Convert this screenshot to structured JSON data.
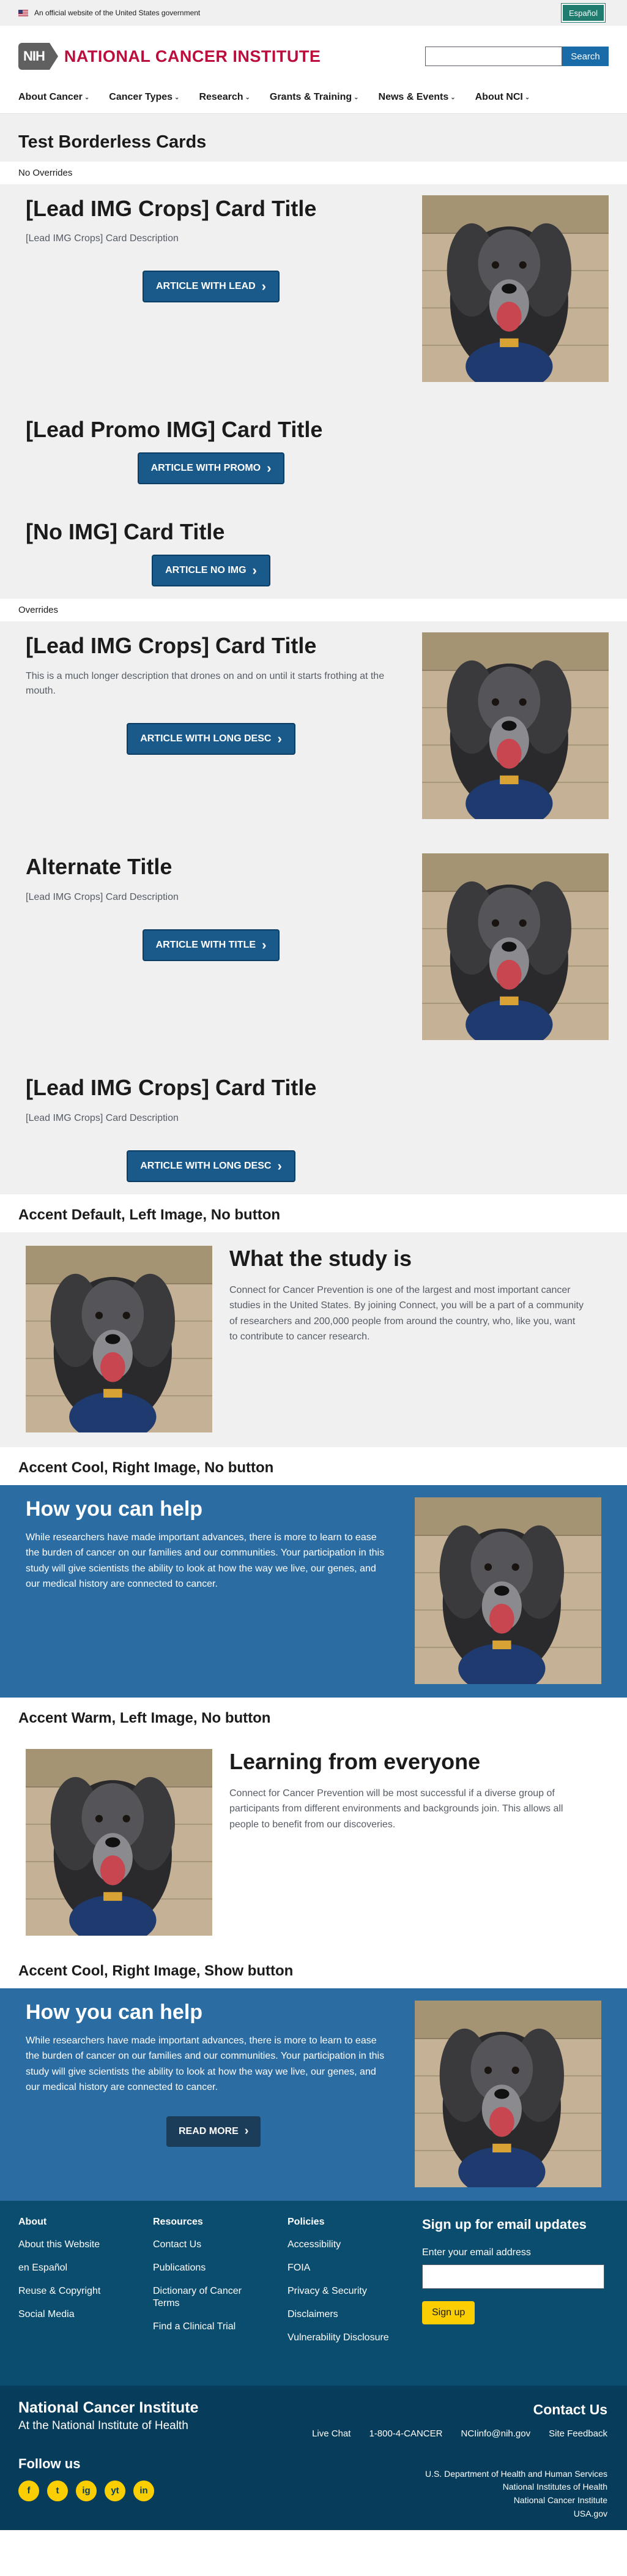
{
  "banner": {
    "text": "An official website of the United States government",
    "espanol": "Español"
  },
  "header": {
    "logo_nih": "NIH",
    "logo_name": "NATIONAL CANCER INSTITUTE",
    "search_button": "Search"
  },
  "nav": [
    {
      "label": "About Cancer"
    },
    {
      "label": "Cancer Types"
    },
    {
      "label": "Research"
    },
    {
      "label": "Grants & Training"
    },
    {
      "label": "News & Events"
    },
    {
      "label": "About NCI"
    }
  ],
  "page_title": "Test Borderless Cards",
  "no_overrides": {
    "label": "No Overrides",
    "cards": [
      {
        "title": "[Lead IMG Crops] Card Title",
        "desc": "[Lead IMG Crops] Card Description",
        "button": "ARTICLE WITH LEAD"
      },
      {
        "title": "[Lead Promo IMG] Card Title",
        "desc": "",
        "button": "ARTICLE WITH PROMO"
      },
      {
        "title": "[No IMG] Card Title",
        "desc": "",
        "button": "ARTICLE NO IMG"
      }
    ]
  },
  "overrides": {
    "label": "Overrides",
    "cards": [
      {
        "title": "[Lead IMG Crops] Card Title",
        "desc": "This is a much longer description that drones on and on until it starts frothing at the mouth.",
        "button": "ARTICLE WITH LONG DESC"
      },
      {
        "title": "Alternate Title",
        "desc": "[Lead IMG Crops] Card Description",
        "button": "ARTICLE WITH TITLE"
      },
      {
        "title": "[Lead IMG Crops] Card Title",
        "desc": "[Lead IMG Crops] Card Description",
        "button": "ARTICLE WITH LONG DESC"
      }
    ]
  },
  "accents": [
    {
      "heading": "Accent Default, Left Image, No button",
      "title": "What the study is",
      "desc": "Connect for Cancer Prevention is one of the largest and most important cancer studies in the United States. By joining Connect, you will be a part of a community of researchers and 200,000 people from around the country, who, like you, want to contribute to cancer research."
    },
    {
      "heading": "Accent Cool, Right Image, No button",
      "title": "How you can help",
      "desc": "While researchers have made important advances, there is more to learn to ease the burden of cancer on our families and our communities. Your participation in this study will give scientists the ability to look at how the way we live, our genes, and our medical history are connected to cancer."
    },
    {
      "heading": "Accent Warm, Left Image, No button",
      "title": "Learning from everyone",
      "desc": "Connect for Cancer Prevention will be most successful if a diverse group of participants from different environments and backgrounds join. This allows all people to benefit from our discoveries."
    },
    {
      "heading": "Accent Cool, Right Image, Show button",
      "title": "How you can help",
      "desc": "While researchers have made important advances, there is more to learn to ease the burden of cancer on our families and our communities. Your participation in this study will give scientists the ability to look at how the way we live, our genes, and our medical history are connected to cancer.",
      "button": "READ MORE"
    }
  ],
  "footer": {
    "about": {
      "heading": "About",
      "links": [
        "About this Website",
        "en Español",
        "Reuse & Copyright",
        "Social Media"
      ]
    },
    "resources": {
      "heading": "Resources",
      "links": [
        "Contact Us",
        "Publications",
        "Dictionary of Cancer Terms",
        "Find a Clinical Trial"
      ]
    },
    "policies": {
      "heading": "Policies",
      "links": [
        "Accessibility",
        "FOIA",
        "Privacy & Security",
        "Disclaimers",
        "Vulnerability Disclosure"
      ]
    },
    "signup": {
      "heading": "Sign up for email updates",
      "label": "Enter your email address",
      "button": "Sign up"
    },
    "nci": "National Cancer Institute",
    "nih": "At the National Institute of Health",
    "contact_heading": "Contact Us",
    "contact_links": [
      "Live Chat",
      "1-800-4-CANCER",
      "NCIinfo@nih.gov",
      "Site Feedback"
    ],
    "follow": "Follow us",
    "socials": [
      "f",
      "t",
      "ig",
      "yt",
      "in"
    ],
    "gov_links": [
      "U.S. Department of Health and Human Services",
      "National Institutes of Health",
      "National Cancer Institute",
      "USA.gov"
    ]
  }
}
